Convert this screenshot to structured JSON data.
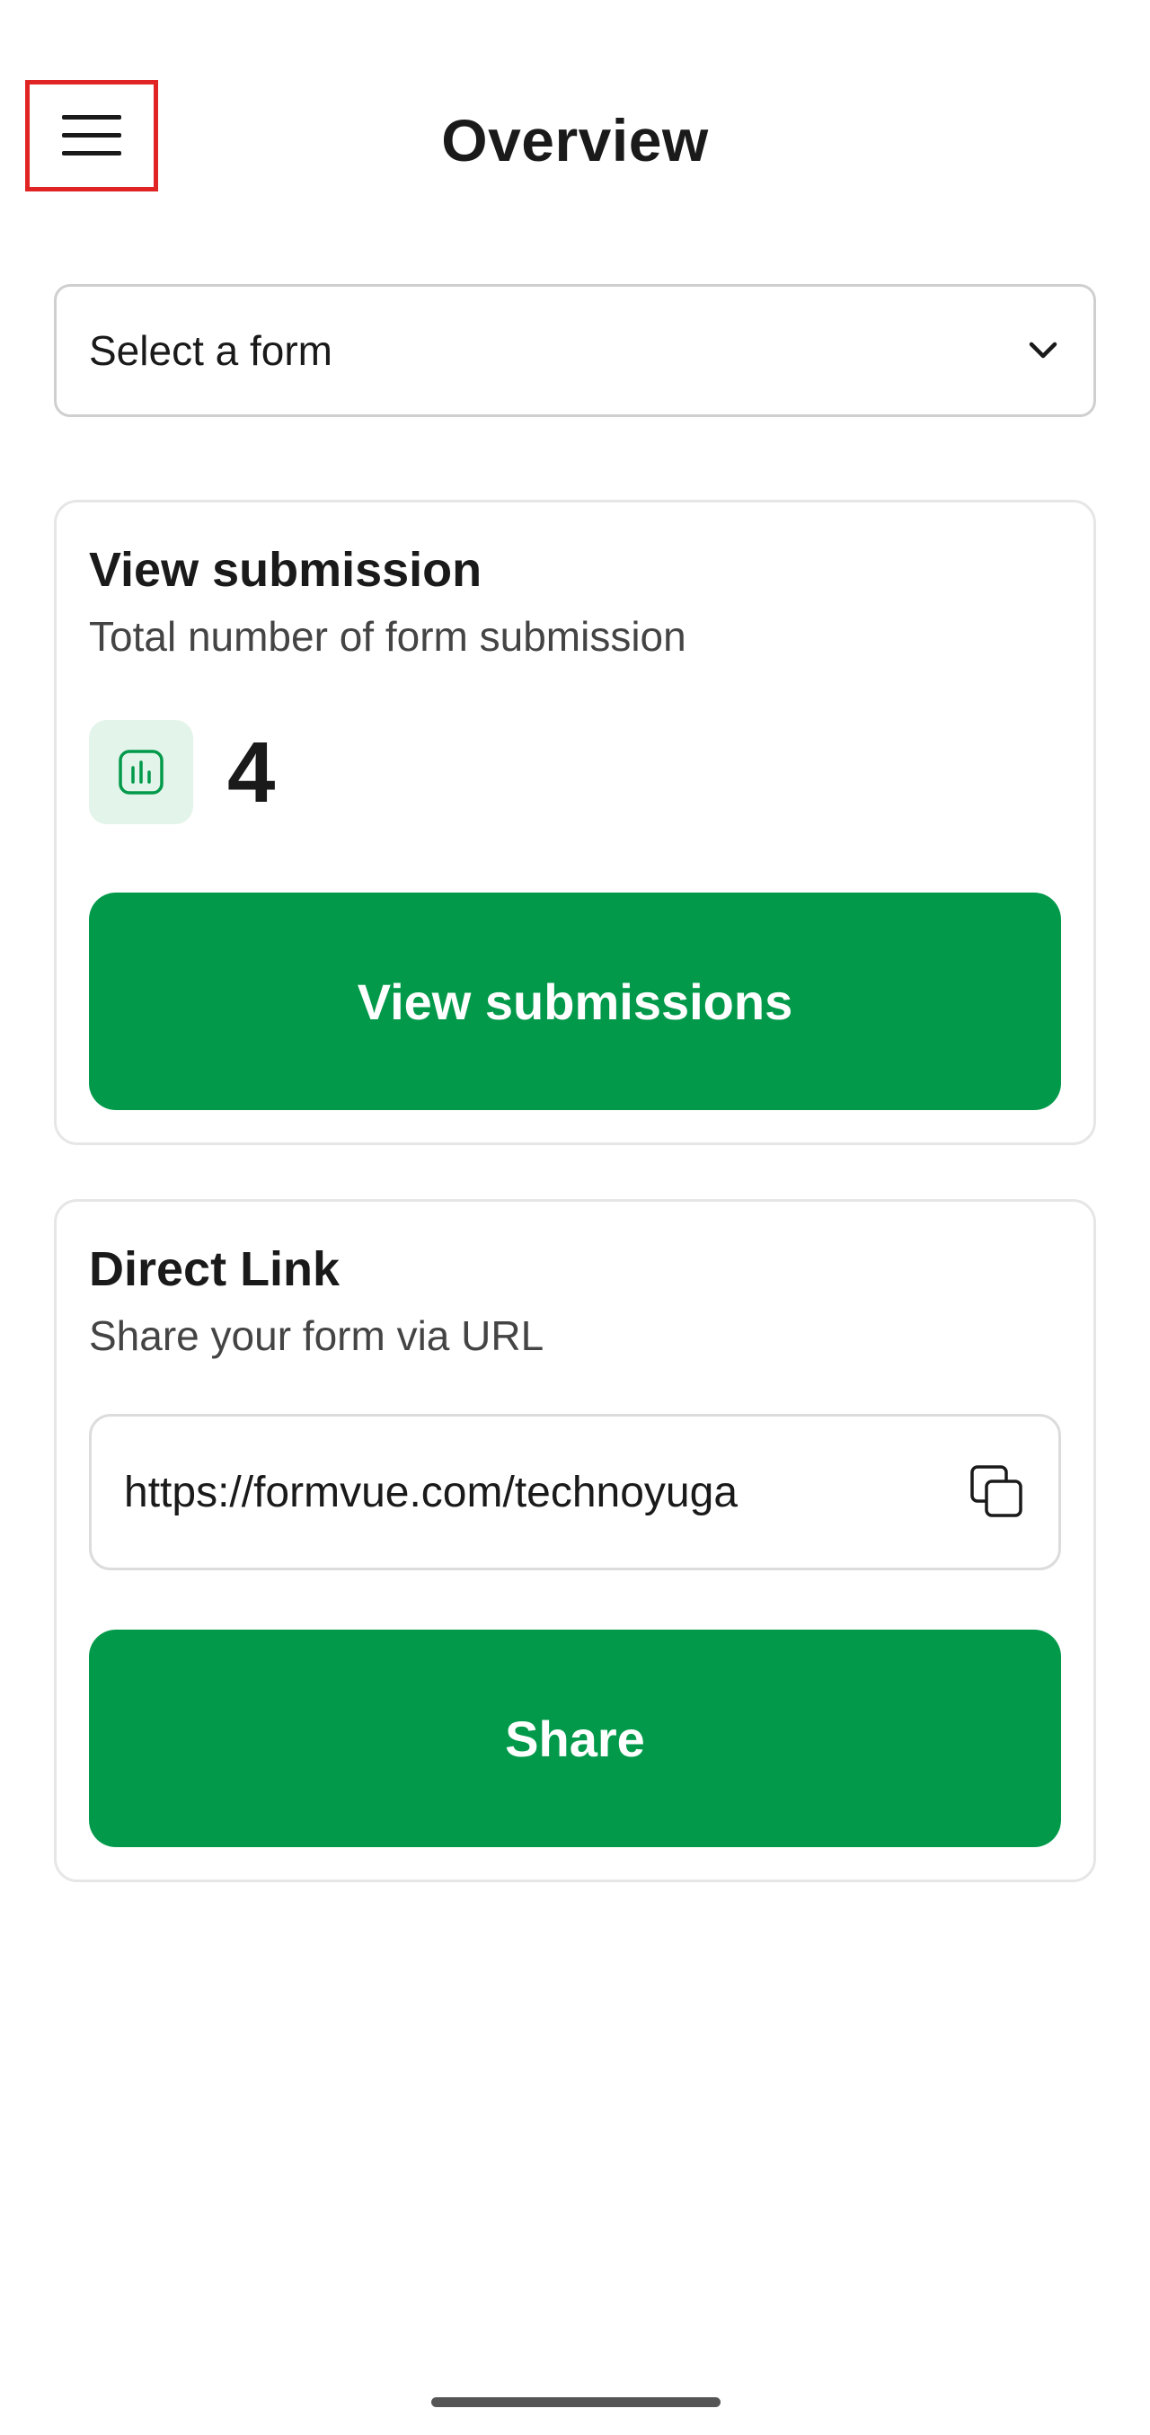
{
  "header": {
    "title": "Overview",
    "menu_icon": "hamburger-menu-icon"
  },
  "form_select": {
    "selected": "Select a form",
    "icon": "chevron-down-icon"
  },
  "submission_card": {
    "title": "View submission",
    "subtitle": "Total number of form submission",
    "icon": "bar-chart-icon",
    "count": "4",
    "button_label": "View submissions"
  },
  "link_card": {
    "title": "Direct Link",
    "subtitle": "Share your form via URL",
    "url": "https://formvue.com/technoyuga",
    "copy_icon": "copy-icon",
    "button_label": "Share"
  },
  "colors": {
    "primary": "#029a4a",
    "icon_bg": "#e3f4ea",
    "highlight": "#e02424"
  }
}
